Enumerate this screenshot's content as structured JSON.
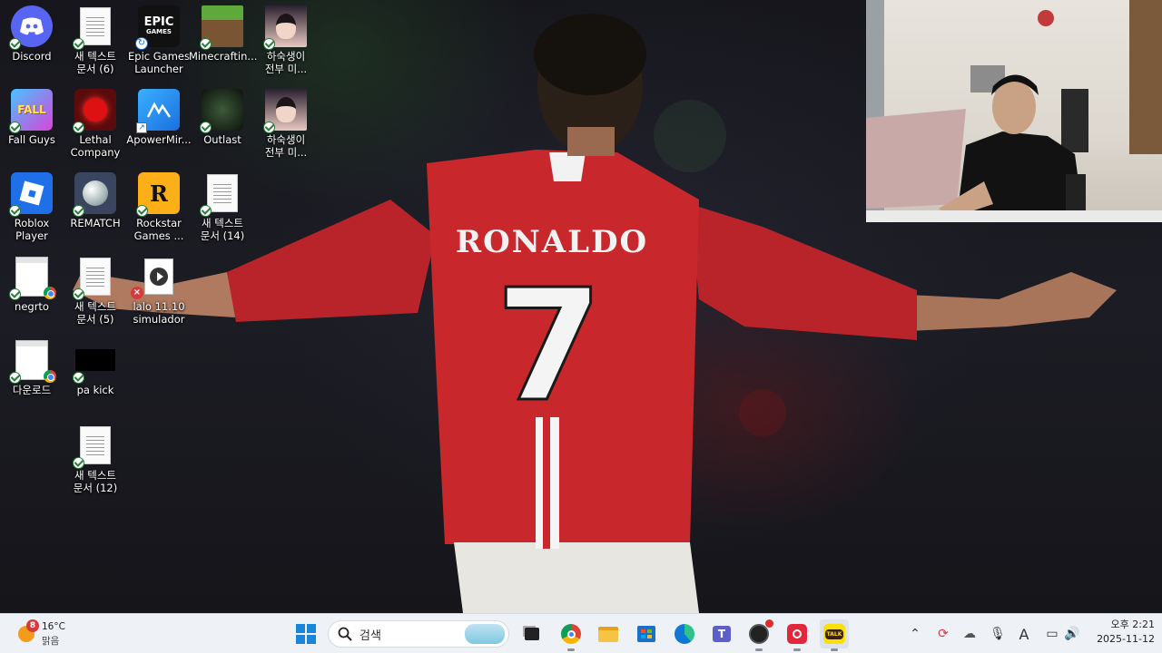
{
  "desktop": {
    "icons": [
      {
        "label": "Discord"
      },
      {
        "label": "새 텍스트\n문서 (6)"
      },
      {
        "label": "Epic Games\nLauncher"
      },
      {
        "label": "Minecraftin..."
      },
      {
        "label": "하숙생이\n전부 미..."
      },
      {
        "label": "Fall Guys"
      },
      {
        "label": "Lethal\nCompany"
      },
      {
        "label": "ApowerMir..."
      },
      {
        "label": "Outlast"
      },
      {
        "label": "하숙생이\n전부 미..."
      },
      {
        "label": "Roblox\nPlayer"
      },
      {
        "label": "REMATCH"
      },
      {
        "label": "Rockstar\nGames ..."
      },
      {
        "label": "새 텍스트\n문서 (14)"
      },
      {
        "label": "negrto"
      },
      {
        "label": "새 텍스트\n문서 (5)"
      },
      {
        "label": "lalo 11.10\nsimulador"
      },
      {
        "label": "다운로드"
      },
      {
        "label": "pa kick"
      },
      {
        "label": "새 텍스트\n문서 (12)"
      }
    ],
    "epic_logo_text": [
      "EPIC",
      "GAMES"
    ],
    "wallpaper": {
      "jersey_name": "RONALDO",
      "jersey_number": "7",
      "jersey_color": "#c8282c"
    }
  },
  "taskbar": {
    "weather": {
      "temp": "16°C",
      "condition": "맑음",
      "badge": "8"
    },
    "search": {
      "placeholder": "검색"
    },
    "clock": {
      "period_time": "오후 2:21",
      "date": "2025-11-12"
    },
    "ime": "A",
    "kakao_label": "TALK"
  }
}
